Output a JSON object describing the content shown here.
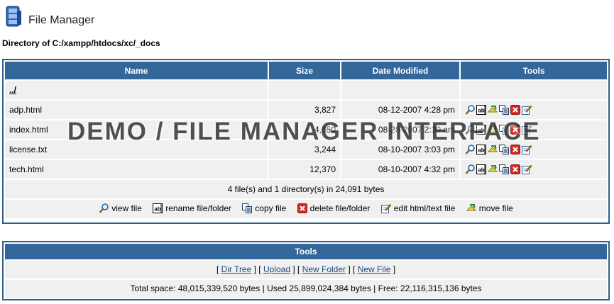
{
  "app": {
    "title": "File Manager"
  },
  "directory": {
    "label": "Directory of C:/xampp/htdocs/xc/_docs"
  },
  "table": {
    "headers": {
      "name": "Name",
      "size": "Size",
      "date": "Date Modified",
      "tools": "Tools"
    },
    "parent": "../",
    "rows": [
      {
        "name": "adp.html",
        "size": "3,827",
        "date": "08-12-2007 4:28 pm"
      },
      {
        "name": "index.html",
        "size": "4,650",
        "date": "08-28-2007 2:30 am"
      },
      {
        "name": "license.txt",
        "size": "3,244",
        "date": "08-10-2007 3:03 pm"
      },
      {
        "name": "tech.html",
        "size": "12,370",
        "date": "08-10-2007 4:32 pm"
      }
    ],
    "summary": "4 file(s) and 1 directory(s) in 24,091 bytes",
    "legend": {
      "view": "view file",
      "rename": "rename file/folder",
      "copy": "copy file",
      "delete": "delete file/folder",
      "edit": "edit html/text file",
      "move": "move file"
    }
  },
  "tools_panel": {
    "title": "Tools",
    "links": {
      "dir_tree": "Dir Tree",
      "upload": "Upload",
      "new_folder": "New Folder",
      "new_file": "New File"
    },
    "disk": "Total space: 48,015,339,520 bytes | Used 25,899,024,384 bytes | Free: 22,116,315,136 bytes"
  },
  "watermark": "DEMO / FILE MANAGER INTERFACE",
  "colors": {
    "header_bg": "#336699",
    "border": "#2f5e8c",
    "cell_bg": "#f0f0f0"
  }
}
